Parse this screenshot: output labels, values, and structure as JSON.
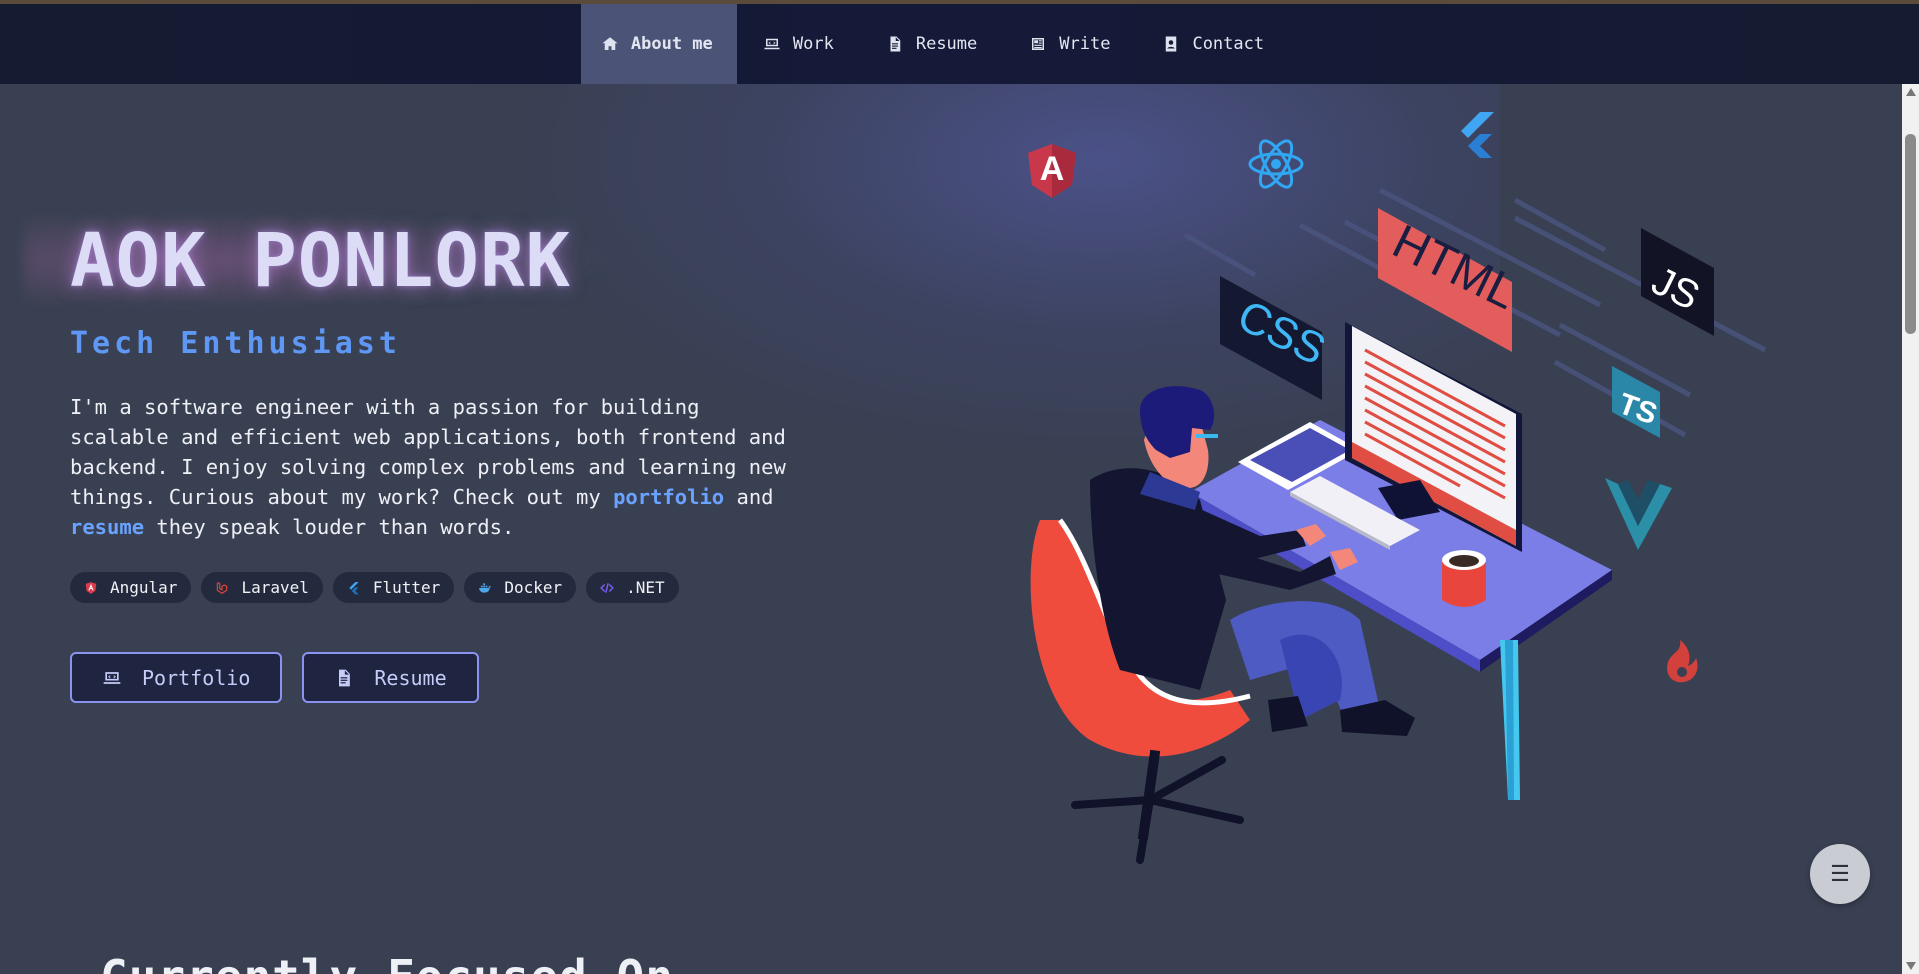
{
  "nav": {
    "items": [
      {
        "label": "About me",
        "icon": "home-icon",
        "active": true
      },
      {
        "label": "Work",
        "icon": "laptop-icon"
      },
      {
        "label": "Resume",
        "icon": "document-icon"
      },
      {
        "label": "Write",
        "icon": "newspaper-icon"
      },
      {
        "label": "Contact",
        "icon": "contact-card-icon"
      }
    ]
  },
  "hero": {
    "name": "AOK PONLORK",
    "subtitle": "Tech Enthusiast",
    "bio_before": "I'm a software engineer with a passion for building scalable and efficient web applications, both frontend and backend. I enjoy solving complex problems and learning new things. Curious about my work? Check out my ",
    "bio_link1": "portfolio",
    "bio_middle": " and ",
    "bio_link2": "resume",
    "bio_after": " they speak louder than words.",
    "tags": [
      {
        "label": "Angular",
        "icon": "angular-icon",
        "color": "#dd3b4c"
      },
      {
        "label": "Laravel",
        "icon": "laravel-icon",
        "color": "#e0453a"
      },
      {
        "label": "Flutter",
        "icon": "flutter-icon",
        "color": "#3da5f0"
      },
      {
        "label": "Docker",
        "icon": "docker-icon",
        "color": "#4fa6e8"
      },
      {
        "label": ".NET",
        "icon": "code-icon",
        "color": "#7b5cf0"
      }
    ],
    "buttons": {
      "portfolio": "Portfolio",
      "resume": "Resume"
    }
  },
  "illustration": {
    "labels": {
      "html": "HTML",
      "css": "CSS",
      "js": "JS",
      "ts": "TS",
      "angular": "A"
    }
  },
  "section": {
    "title": "Currently Focused On"
  },
  "menu": {
    "icon": "menu-icon",
    "glyph": "☰"
  },
  "colors": {
    "accent": "#5f97f5",
    "button_border": "#8b93f0",
    "background": "#394052",
    "nav_bg": "#151b30"
  }
}
